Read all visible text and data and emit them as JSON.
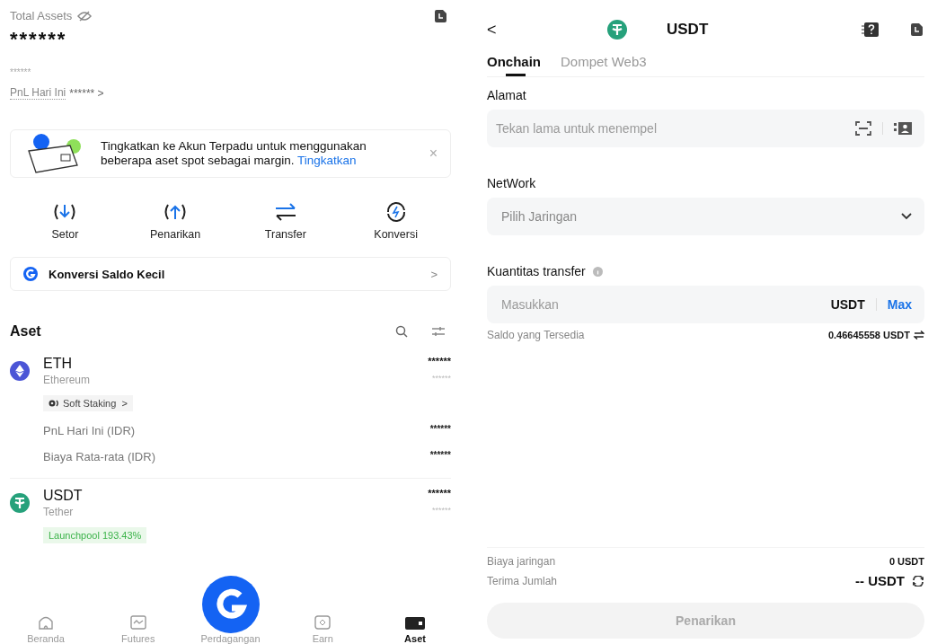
{
  "assets_screen": {
    "total_label": "Total Assets",
    "total_value": "******",
    "total_sub": "******",
    "pnl_label": "PnL Hari Ini",
    "pnl_value": "******",
    "pnl_arrow": ">",
    "banner": {
      "text": "Tingkatkan ke Akun Terpadu untuk menggunakan beberapa aset spot sebagai margin.",
      "link": "Tingkatkan",
      "close": "×"
    },
    "actions": [
      {
        "label": "Setor",
        "kind": "deposit"
      },
      {
        "label": "Penarikan",
        "kind": "withdraw"
      },
      {
        "label": "Transfer",
        "kind": "transfer"
      },
      {
        "label": "Konversi",
        "kind": "convert"
      }
    ],
    "small_convert": {
      "label": "Konversi Saldo Kecil",
      "arrow": ">"
    },
    "list_title": "Aset",
    "items": [
      {
        "symbol": "ETH",
        "name": "Ethereum",
        "kind": "eth",
        "balance": "******",
        "balance_sub": "******",
        "tag": {
          "label": "Soft Staking",
          "arrow": ">",
          "kind": "staking"
        },
        "details": [
          {
            "label": "PnL Hari Ini (IDR)",
            "value": "******"
          },
          {
            "label": "Biaya Rata-rata (IDR)",
            "value": "******"
          }
        ]
      },
      {
        "symbol": "USDT",
        "name": "Tether",
        "kind": "usdt",
        "balance": "******",
        "balance_sub": "******",
        "tag": {
          "label": "Launchpool 193.43%",
          "kind": "launchpool"
        }
      }
    ],
    "nav": [
      {
        "label": "Beranda",
        "kind": "home",
        "selected": false
      },
      {
        "label": "Futures",
        "kind": "futures",
        "selected": false
      },
      {
        "label": "Perdagangan",
        "kind": "trade",
        "selected": false
      },
      {
        "label": "Earn",
        "kind": "earn",
        "selected": false
      },
      {
        "label": "Aset",
        "kind": "wallet",
        "selected": true
      }
    ]
  },
  "withdraw_screen": {
    "back": "<",
    "title": "USDT",
    "tabs": [
      {
        "label": "Onchain",
        "selected": true
      },
      {
        "label": "Dompet Web3",
        "selected": false
      }
    ],
    "address": {
      "label": "Alamat",
      "placeholder": "Tekan lama untuk menempel"
    },
    "network": {
      "label": "NetWork",
      "placeholder": "Pilih Jaringan"
    },
    "quantity": {
      "label": "Kuantitas transfer",
      "placeholder": "Masukkan",
      "unit": "USDT",
      "max": "Max"
    },
    "available": {
      "label": "Saldo yang Tersedia",
      "value": "0.46645558 USDT"
    },
    "fee": {
      "label": "Biaya jaringan",
      "value": "0 USDT"
    },
    "receive": {
      "label": "Terima Jumlah",
      "value": "-- USDT"
    },
    "submit": {
      "label": "Penarikan",
      "disabled": true
    }
  }
}
